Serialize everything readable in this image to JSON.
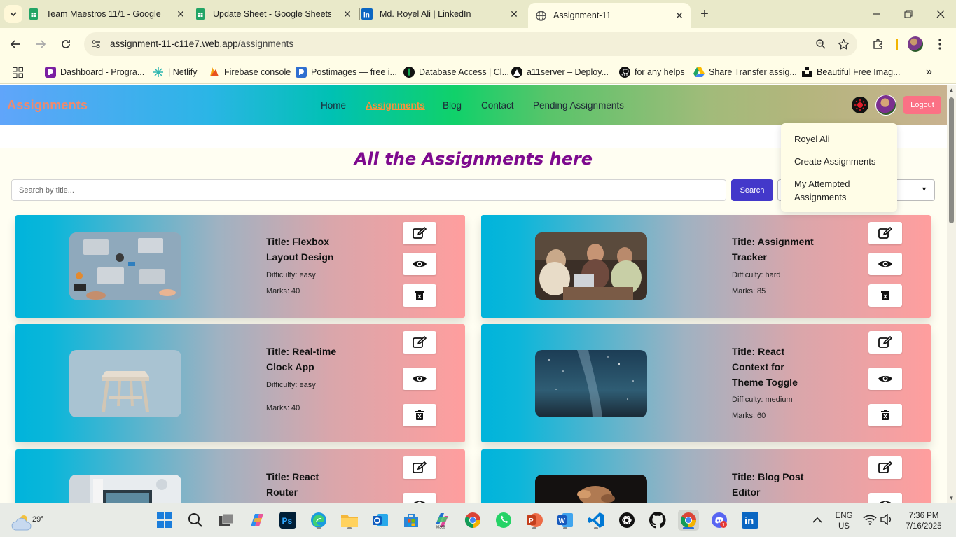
{
  "browser": {
    "tabs": [
      {
        "title": "Team Maestros 11/1 - Google Sheets",
        "icon": "google-sheets-icon",
        "active": false
      },
      {
        "title": "Update Sheet - Google Sheets",
        "icon": "google-sheets-icon",
        "active": false
      },
      {
        "title": "Md. Royel Ali | LinkedIn",
        "icon": "linkedin-icon",
        "active": false
      },
      {
        "title": "Assignment-11",
        "icon": "globe-icon",
        "active": true
      }
    ],
    "url_host": "assignment-11-c11e7.web.app",
    "url_path": "/assignments",
    "bookmarks": [
      {
        "label": "Dashboard - Progra...",
        "icon": "programming-hero-icon"
      },
      {
        "label": "| Netlify",
        "icon": "netlify-icon"
      },
      {
        "label": "Firebase console",
        "icon": "firebase-icon"
      },
      {
        "label": "Postimages — free i...",
        "icon": "postimages-icon"
      },
      {
        "label": "Database Access | Cl...",
        "icon": "mongodb-icon"
      },
      {
        "label": "a11server – Deploy...",
        "icon": "vercel-icon"
      },
      {
        "label": "for any helps",
        "icon": "github-icon"
      },
      {
        "label": "Share Transfer assig...",
        "icon": "google-drive-icon"
      },
      {
        "label": "Beautiful Free Imag...",
        "icon": "unsplash-icon"
      }
    ]
  },
  "site": {
    "brand": "Assignments",
    "nav": [
      "Home",
      "Assignments",
      "Blog",
      "Contact",
      "Pending Assignments"
    ],
    "active_nav": "Assignments",
    "logout_label": "Logout",
    "dropdown": [
      "Royel Ali",
      "Create Assignments",
      "My Attempted Assignments"
    ],
    "page_title": "All the Assignments here",
    "search_placeholder": "Search by title...",
    "search_button": "Search",
    "accent_color": "#4338ca",
    "title_color": "#7e0a8e"
  },
  "assignments": [
    {
      "title": "Title: Flexbox Layout Design",
      "difficulty": "Difficulty: easy",
      "marks": "Marks: 40",
      "image": "team-laptops-photo"
    },
    {
      "title": "Title: Assignment Tracker",
      "difficulty": "Difficulty: hard",
      "marks": "Marks: 85",
      "image": "friends-cafe-photo"
    },
    {
      "title": "Title: Real-time Clock App",
      "difficulty": "Difficulty: easy",
      "marks": "Marks: 40",
      "image": "wooden-stool-photo"
    },
    {
      "title": "Title: React Context for Theme Toggle",
      "difficulty": "Difficulty: medium",
      "marks": "Marks: 60",
      "image": "milky-way-photo"
    },
    {
      "title": "Title: React Router",
      "difficulty": "",
      "marks": "",
      "image": "desk-monitor-photo"
    },
    {
      "title": "Title: Blog Post Editor",
      "difficulty": "",
      "marks": "",
      "image": "dark-hands-photo"
    }
  ],
  "taskbar": {
    "temperature": "29°",
    "language": "ENG",
    "region": "US",
    "time": "7:36 PM",
    "date": "7/16/2025"
  }
}
